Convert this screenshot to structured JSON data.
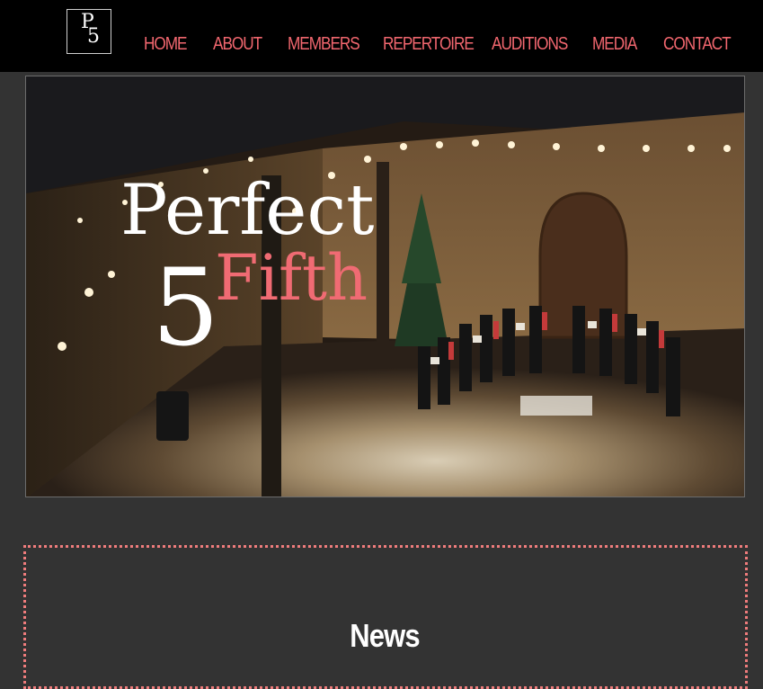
{
  "header": {
    "logo": {
      "letter": "P",
      "number": "5"
    },
    "nav": [
      {
        "label": "HOME"
      },
      {
        "label": "ABOUT"
      },
      {
        "label": "MEMBERS"
      },
      {
        "label": "REPERTOIRE"
      },
      {
        "label": "AUDITIONS"
      },
      {
        "label": "MEDIA"
      },
      {
        "label": "CONTACT"
      }
    ],
    "colors": {
      "bar": "#000000",
      "nav_text": "#f2676f"
    }
  },
  "hero": {
    "title_word": "Perfect",
    "title_number": "5",
    "title_accent": "Fifth",
    "accent_color": "#f06b73"
  },
  "news": {
    "title": "News",
    "border_color": "#ef7c7c"
  },
  "page": {
    "background": "#333333"
  }
}
